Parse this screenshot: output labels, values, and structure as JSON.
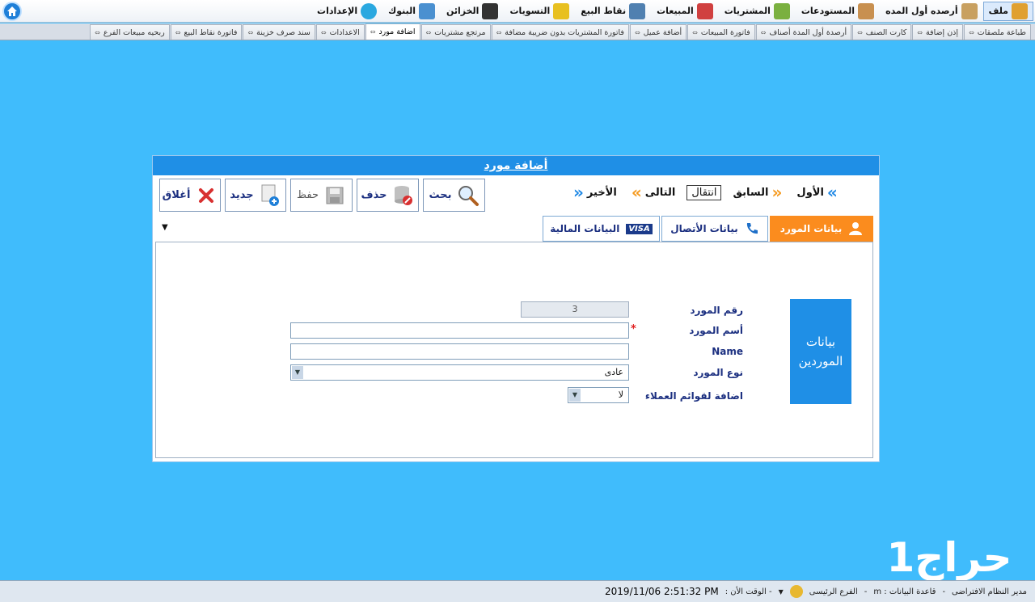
{
  "menubar": {
    "items": [
      {
        "label": "ملف",
        "icon": "file-menu-icon",
        "color": "#e0a030"
      },
      {
        "label": "أرصده أول المده",
        "icon": "boxes-icon",
        "color": "#c8a060"
      },
      {
        "label": "المستودعات",
        "icon": "warehouse-icon",
        "color": "#c89050"
      },
      {
        "label": "المشتريات",
        "icon": "purchases-icon",
        "color": "#7ab040"
      },
      {
        "label": "المبيعات",
        "icon": "cart-icon",
        "color": "#d04040"
      },
      {
        "label": "نقاط البيع",
        "icon": "pos-icon",
        "color": "#5080b0"
      },
      {
        "label": "التسويات",
        "icon": "lock-icon",
        "color": "#e8c020"
      },
      {
        "label": "الخزائن",
        "icon": "safe-icon",
        "color": "#333333"
      },
      {
        "label": "البنوك",
        "icon": "bank-icon",
        "color": "#4a90d0"
      },
      {
        "label": "الإعدادات",
        "icon": "settings-icon",
        "color": "#2aa8e0"
      }
    ]
  },
  "doc_tabs": [
    {
      "label": "طباعة ملصقات",
      "selected": false
    },
    {
      "label": "إذن إضافة",
      "selected": false
    },
    {
      "label": "كارت الصنف",
      "selected": false
    },
    {
      "label": "أرصدة أول المدة أصناف",
      "selected": false
    },
    {
      "label": "فاتورة المبيعات",
      "selected": false
    },
    {
      "label": "أضافة عميل",
      "selected": false
    },
    {
      "label": "فاتورة المشتريات بدون ضريبة مضافة",
      "selected": false
    },
    {
      "label": "مرتجع مشتريات",
      "selected": false
    },
    {
      "label": "اضافة مورد",
      "selected": true
    },
    {
      "label": "الاعدادات",
      "selected": false
    },
    {
      "label": "سند صرف خزينة",
      "selected": false
    },
    {
      "label": "فاتورة نقاط البيع",
      "selected": false
    },
    {
      "label": "ربحيه مبيعات الفرع",
      "selected": false
    }
  ],
  "form": {
    "title": "أضافة مورد",
    "toolbar": {
      "close": "أغلاق",
      "new": "جديد",
      "save": "حفظ",
      "delete": "حذف",
      "search": "بحث"
    },
    "nav": {
      "first": "الأول",
      "previous": "السابق",
      "move": "انتقال",
      "next": "التالى",
      "last": "الأخير"
    },
    "section_tabs": {
      "supplier": "بيانات المورد",
      "contact": "بيانات الأتصال",
      "financial": "البيانات المالية",
      "visa_badge": "VISA"
    },
    "side_card": "بيانات الموردين",
    "fields": {
      "number_label": "رقم المورد",
      "number_value": "3",
      "name_label": "أسم المورد",
      "name_value": "",
      "name_en_label": "Name",
      "name_en_value": "",
      "type_label": "نوع المورد",
      "type_value": "عادى",
      "add_customers_label": "اضافة لقوائم العملاء",
      "add_customers_value": "لا",
      "required_mark": "*"
    }
  },
  "statusbar": {
    "user": "مدير النظام الافتراضى",
    "sep1": "-",
    "database": "قاعدة البيانات : m",
    "sep2": "-",
    "branch": "الفرع الرئيسى",
    "time_label": "- الوقت الأن :",
    "time_value": "2019/11/06 2:51:32 PM"
  },
  "watermark": "حراج1"
}
